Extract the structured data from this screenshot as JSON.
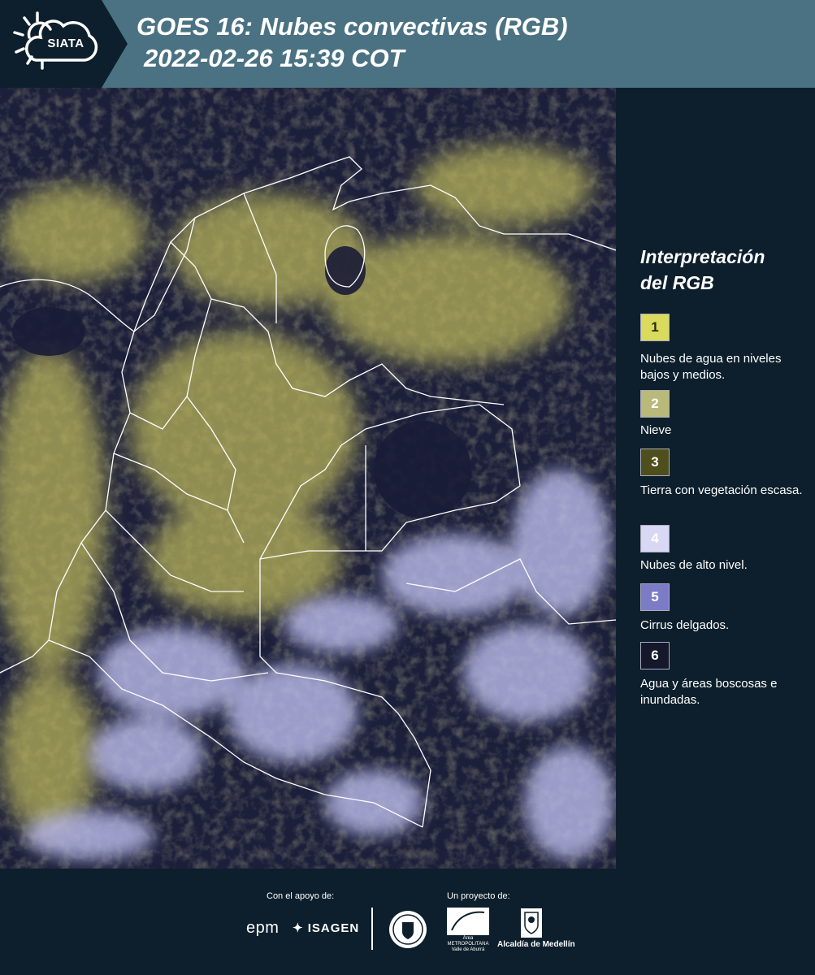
{
  "header": {
    "logo_text": "SIATA",
    "title_line1": "GOES 16: Nubes convectivas (RGB)",
    "title_line2": "2022-02-26 15:39 COT",
    "background_color": "#4a7282",
    "logo_tab_color": "#0d1f2c"
  },
  "legend": {
    "title_line1": "Interpretación",
    "title_line2": "del RGB",
    "items": [
      {
        "number": "1",
        "label": "Nubes de agua en niveles bajos y medios.",
        "color": "#dada5c",
        "text_color": "#2b2b15"
      },
      {
        "number": "2",
        "label": "Nieve",
        "color": "#b9b97a",
        "text_color": "#ffffff"
      },
      {
        "number": "3",
        "label": "Tierra con vegetación escasa.",
        "color": "#4f4f1d",
        "text_color": "#ffffff"
      },
      {
        "number": "4",
        "label": "Nubes de alto nivel.",
        "color": "#d8d8f5",
        "text_color": "#ffffff"
      },
      {
        "number": "5",
        "label": "Cirrus delgados.",
        "color": "#7b7bc6",
        "text_color": "#ffffff"
      },
      {
        "number": "6",
        "label": "Agua y áreas boscosas e inundadas.",
        "color": "#15172a",
        "text_color": "#ffffff"
      }
    ]
  },
  "map": {
    "base_color": "#1c1f3a",
    "cloud_low_color": "#c9c466",
    "cloud_high_color": "#c8c8ee",
    "border_color": "#ffffff"
  },
  "footer": {
    "support_label": "Con el apoyo de:",
    "project_label": "Un proyecto de:",
    "epm": "epm",
    "isagen": "ISAGEN",
    "area_name": "Área",
    "area_caption": "METROPOLITANA Valle de Aburrá",
    "alcaldia": "Alcaldía de Medellín"
  }
}
